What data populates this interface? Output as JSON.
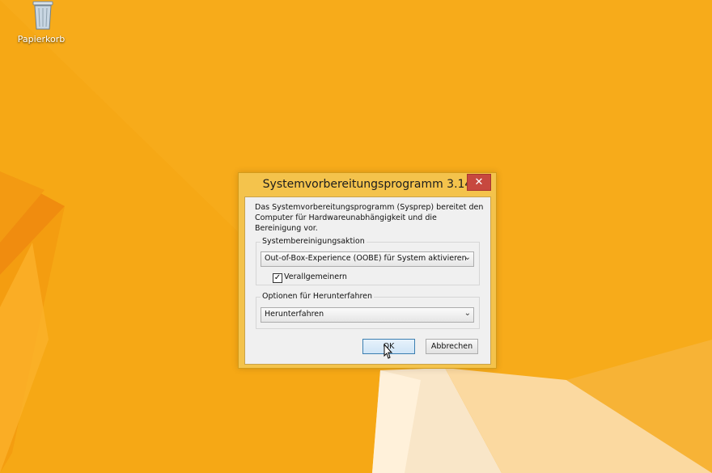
{
  "desktop": {
    "recycle_bin_label": "Papierkorb",
    "recycle_bin_icon": "recycle-bin-icon"
  },
  "dialog": {
    "title": "Systemvorbereitungsprogramm 3.14",
    "close_icon": "close-icon",
    "description": "Das Systemvorbereitungsprogramm (Sysprep) bereitet den Computer für Hardwareunabhängigkeit und die Bereinigung vor.",
    "cleanup_group": {
      "label": "Systembereinigungsaktion",
      "selected_option": "Out-of-Box-Experience (OOBE) für System aktivieren",
      "generalize_label": "Verallgemeinern",
      "generalize_checked": true
    },
    "shutdown_group": {
      "label": "Optionen für Herunterfahren",
      "selected_option": "Herunterfahren"
    },
    "buttons": {
      "ok": "OK",
      "cancel": "Abbrechen"
    }
  },
  "colors": {
    "wallpaper_orange": "#f5a613",
    "dialog_frame": "#f4c34c",
    "close_red": "#c7483f"
  }
}
